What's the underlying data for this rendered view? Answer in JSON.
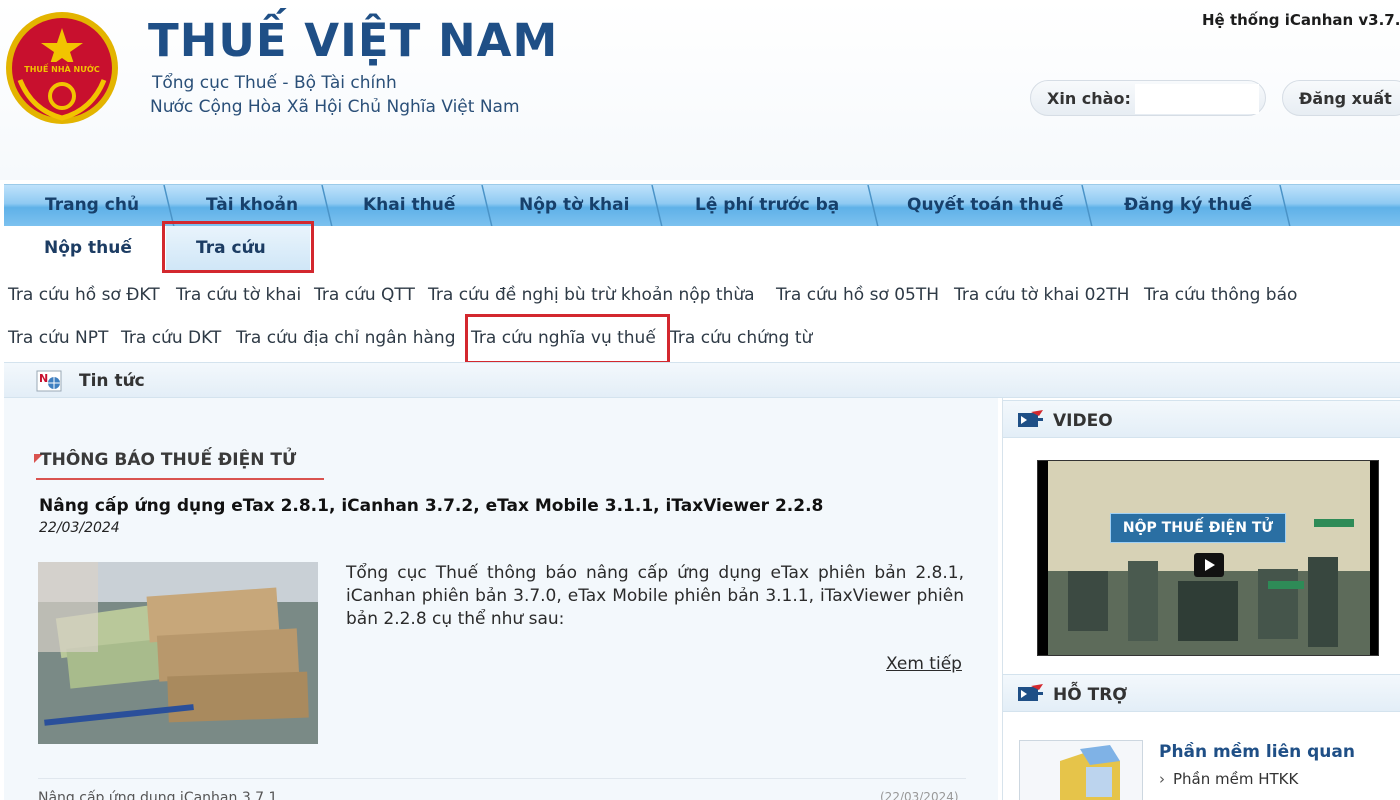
{
  "header": {
    "title": "THUẾ VIỆT NAM",
    "subtitle_line1": "Tổng cục Thuế - Bộ Tài chính",
    "subtitle_line2": "Nước Cộng Hòa Xã Hội Chủ Nghĩa Việt Nam",
    "emblem_text": "THUẾ NHÀ NƯỚC",
    "system_version": "Hệ thống iCanhan v3.7.",
    "greeting_label": "Xin chào:",
    "greeting_name": "",
    "logout_label": "Đăng xuất"
  },
  "main_nav": {
    "items": [
      {
        "label": "Trang chủ"
      },
      {
        "label": "Tài khoản"
      },
      {
        "label": "Khai thuế"
      },
      {
        "label": "Nộp tờ khai"
      },
      {
        "label": "Lệ phí trước bạ"
      },
      {
        "label": "Quyết toán thuế"
      },
      {
        "label": "Đăng ký thuế"
      }
    ]
  },
  "sub_nav": {
    "tabs": [
      {
        "label": "Nộp thuế",
        "active": false
      },
      {
        "label": "Tra cứu",
        "active": true
      }
    ]
  },
  "lookup_links": {
    "row1": [
      "Tra cứu hồ sơ ĐKT",
      "Tra cứu tờ khai",
      "Tra cứu QTT",
      "Tra cứu đề nghị bù trừ khoản nộp thừa",
      "Tra cứu hồ sơ 05TH",
      "Tra cứu tờ khai 02TH",
      "Tra cứu thông báo"
    ],
    "row2": [
      "Tra cứu NPT",
      "Tra cứu DKT",
      "Tra cứu địa chỉ ngân hàng",
      "Tra cứu nghĩa vụ thuế",
      "Tra cứu chứng từ"
    ]
  },
  "news_bar": {
    "label": "Tin tức",
    "icon": "news-icon"
  },
  "content": {
    "section_heading": "THÔNG BÁO THUẾ ĐIỆN TỬ",
    "article_title": "Nâng cấp ứng dụng eTax 2.8.1, iCanhan 3.7.2, eTax Mobile 3.1.1, iTaxViewer 2.2.8",
    "article_date": "22/03/2024",
    "article_summary": "Tổng cục Thuế thông báo nâng cấp ứng dụng eTax phiên bản 2.8.1, iCanhan phiên bản 3.7.0, eTax Mobile phiên bản 3.1.1, iTaxViewer phiên bản 2.2.8 cụ thể như sau:",
    "read_more": "Xem tiếp",
    "partial_row_text": "Nâng cấp ứng dụng iCanhan 3.7.1",
    "partial_row_date": "(22/03/2024)"
  },
  "sidebar": {
    "video_title": "VIDEO",
    "video_banner": "NỘP THUẾ ĐIỆN TỬ",
    "support_title": "HỖ TRỢ",
    "support_item_title": "Phần mềm liên quan",
    "support_link": "Phần mềm HTKK"
  },
  "colors": {
    "brand_blue": "#1f4f86",
    "nav_blue": "#5fb1e8",
    "highlight_red": "#d3282e",
    "emblem_red": "#c8102e",
    "emblem_gold": "#f2c400"
  }
}
